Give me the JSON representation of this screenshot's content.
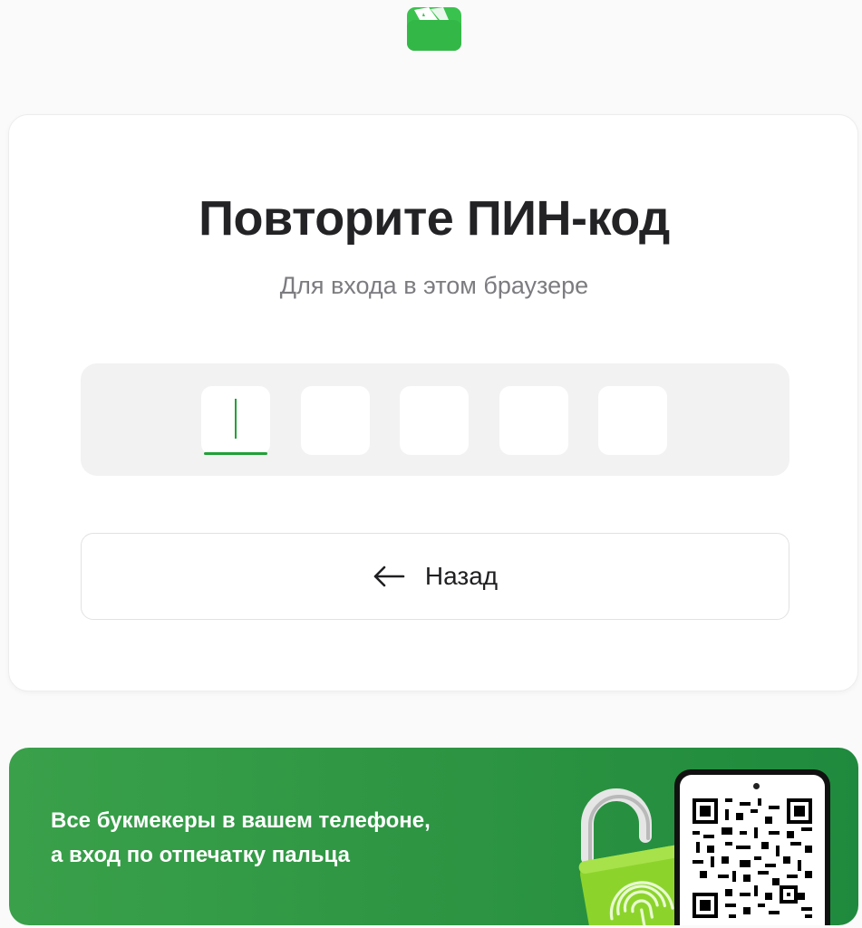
{
  "logo": {
    "icon": "wallet-logo-icon",
    "color": "#3ac24e"
  },
  "card": {
    "title": "Повторите ПИН-код",
    "subtitle": "Для входа в этом браузере",
    "pin": {
      "digits": [
        "",
        "",
        "",
        "",
        ""
      ],
      "active_index": 0,
      "accent": "#21a038"
    },
    "back_button": {
      "label": "Назад",
      "icon": "arrow-left-icon"
    }
  },
  "banner": {
    "line1": "Все букмекеры в вашем телефоне,",
    "line2": "а вход по отпечатку пальца",
    "lock_icon": "fingerprint-lock-icon",
    "qr_icon": "qr-code-icon",
    "colors": {
      "start": "#3aa04a",
      "end": "#1f8a3d"
    }
  }
}
